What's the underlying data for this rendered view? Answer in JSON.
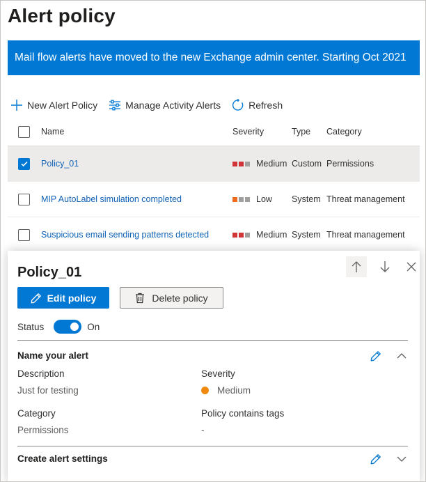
{
  "page": {
    "title": "Alert policy"
  },
  "banner": {
    "text": "Mail flow alerts have moved to the new Exchange admin center. Starting Oct 2021"
  },
  "toolbar": {
    "new_label": "New Alert Policy",
    "manage_label": "Manage Activity Alerts",
    "refresh_label": "Refresh"
  },
  "table": {
    "headers": {
      "name": "Name",
      "severity": "Severity",
      "type": "Type",
      "category": "Category"
    },
    "rows": [
      {
        "name": "Policy_01",
        "severity": "Medium",
        "type": "Custom",
        "category": "Permissions",
        "selected": true
      },
      {
        "name": "MIP AutoLabel simulation completed",
        "severity": "Low",
        "type": "System",
        "category": "Threat management",
        "selected": false
      },
      {
        "name": "Suspicious email sending patterns detected",
        "severity": "Medium",
        "type": "System",
        "category": "Threat management",
        "selected": false
      }
    ]
  },
  "panel": {
    "title": "Policy_01",
    "edit_label": "Edit policy",
    "delete_label": "Delete policy",
    "status_label": "Status",
    "status_value": "On",
    "section1_title": "Name your alert",
    "description_label": "Description",
    "description_value": "Just for testing",
    "severity_label": "Severity",
    "severity_value": "Medium",
    "category_label": "Category",
    "category_value": "Permissions",
    "tags_label": "Policy contains tags",
    "tags_value": "-",
    "section2_title": "Create alert settings"
  },
  "colors": {
    "accent": "#0078d4",
    "link": "#0f62b6",
    "severity_high": "#d13438",
    "severity_low": "#ef6c1e",
    "severity_dot": "#ef8a0e",
    "severity_empty": "#a19f9d"
  },
  "icons": {
    "new": "plus-icon",
    "manage": "sliders-icon",
    "refresh": "refresh-icon",
    "edit": "pencil-icon",
    "delete": "trash-icon",
    "up": "arrow-up-icon",
    "down": "arrow-down-icon",
    "close": "close-icon"
  }
}
